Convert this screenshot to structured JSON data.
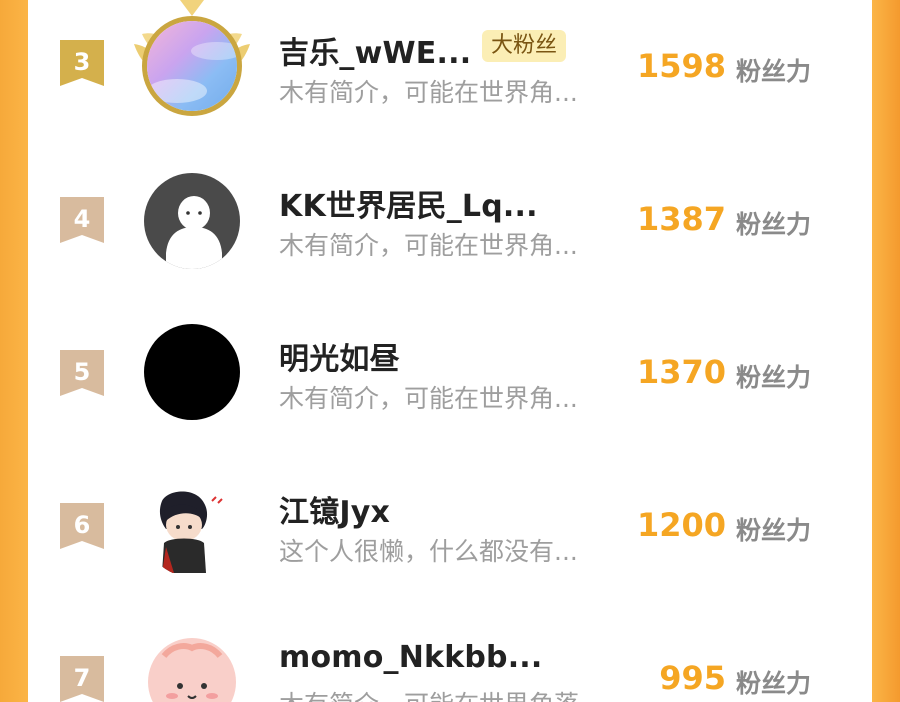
{
  "ranking": {
    "unit_label": "粉丝力",
    "items": [
      {
        "rank": "3",
        "name": "吉乐_wWE...",
        "badge": "大粉丝",
        "desc": "木有简介，可能在世界角...",
        "score": "1598",
        "avatar": "sky-gradient-avatar",
        "crowned": true
      },
      {
        "rank": "4",
        "name": "KK世界居民_Lq...",
        "desc": "木有简介，可能在世界角...",
        "score": "1387",
        "avatar": "default-ghost-avatar"
      },
      {
        "rank": "5",
        "name": "明光如昼",
        "desc": "木有简介，可能在世界角...",
        "score": "1370",
        "avatar": "black-circle-avatar"
      },
      {
        "rank": "6",
        "name": "江镱Jyx",
        "desc": "这个人很懒，什么都没有...",
        "score": "1200",
        "avatar": "anime-boy-avatar"
      },
      {
        "rank": "7",
        "name": "momo_Nkkbb...",
        "desc": "木有简介，可能在世界角落",
        "score": "995",
        "avatar": "pink-blob-avatar"
      }
    ]
  },
  "colors": {
    "score": "#f5a623",
    "gold_badge": "#d9b24a",
    "rank_badge": "#d7b99b",
    "background": "#fbb446"
  }
}
